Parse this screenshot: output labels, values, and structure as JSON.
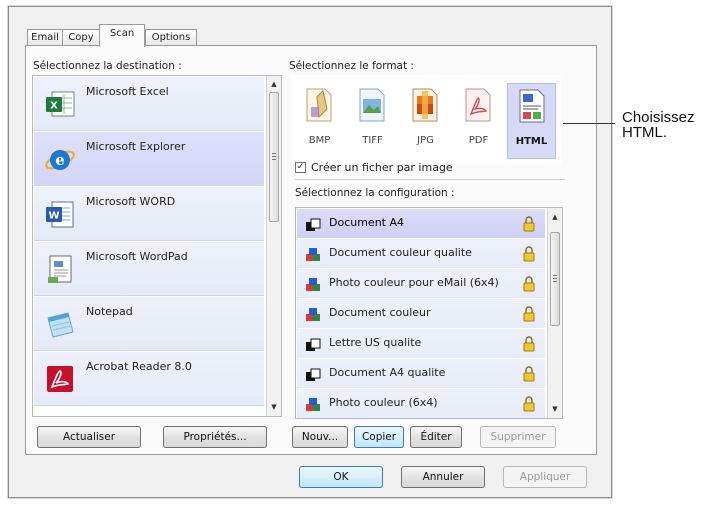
{
  "tabs": [
    {
      "label": "Email",
      "active": false
    },
    {
      "label": "Copy",
      "active": false
    },
    {
      "label": "Scan",
      "active": true
    },
    {
      "label": "Options",
      "active": false
    }
  ],
  "destination": {
    "heading": "Sélectionnez la destination :",
    "items": [
      {
        "label": "Microsoft Excel",
        "icon": "excel-icon",
        "selected": false
      },
      {
        "label": "Microsoft Explorer",
        "icon": "explorer-icon",
        "selected": true
      },
      {
        "label": "Microsoft WORD",
        "icon": "word-icon",
        "selected": false
      },
      {
        "label": "Microsoft WordPad",
        "icon": "wordpad-icon",
        "selected": false
      },
      {
        "label": "Notepad",
        "icon": "notepad-icon",
        "selected": false
      },
      {
        "label": "Acrobat Reader 8.0",
        "icon": "acrobat-icon",
        "selected": false
      }
    ],
    "buttons": {
      "refresh": "Actualiser",
      "properties": "Propriétés..."
    }
  },
  "format": {
    "heading": "Sélectionnez le format :",
    "options": [
      {
        "label": "BMP",
        "icon": "bmp-file-icon",
        "selected": false
      },
      {
        "label": "TIFF",
        "icon": "tiff-file-icon",
        "selected": false
      },
      {
        "label": "JPG",
        "icon": "jpg-file-icon",
        "selected": false
      },
      {
        "label": "PDF",
        "icon": "pdf-file-icon",
        "selected": false
      },
      {
        "label": "HTML",
        "icon": "html-file-icon",
        "selected": true
      }
    ],
    "checkbox": {
      "label": "Créer un ficher par image",
      "checked": true
    }
  },
  "configuration": {
    "heading": "Sélectionnez la configuration :",
    "items": [
      {
        "label": "Document A4",
        "icon": "document-bw-icon",
        "selected": true
      },
      {
        "label": "Document couleur qualite",
        "icon": "document-color-icon",
        "selected": false
      },
      {
        "label": "Photo couleur pour eMail (6x4)",
        "icon": "document-color-icon",
        "selected": false
      },
      {
        "label": "Document couleur",
        "icon": "document-color-icon",
        "selected": false
      },
      {
        "label": "Lettre US qualite",
        "icon": "document-bw-icon",
        "selected": false
      },
      {
        "label": "Document A4 qualite",
        "icon": "document-bw-icon",
        "selected": false
      },
      {
        "label": "Photo couleur (6x4)",
        "icon": "document-color-icon",
        "selected": false
      }
    ],
    "buttons": {
      "new": "Nouv...",
      "copy": "Copier",
      "edit": "Éditer",
      "delete": "Supprimer"
    }
  },
  "footer": {
    "ok": "OK",
    "cancel": "Annuler",
    "apply": "Appliquer"
  },
  "callout": {
    "text": "Choisissez\nHTML."
  },
  "colors": {
    "selection": "#d4d5f8",
    "list_item": "#e6eaf7",
    "focus_border": "#3c7fb1"
  }
}
